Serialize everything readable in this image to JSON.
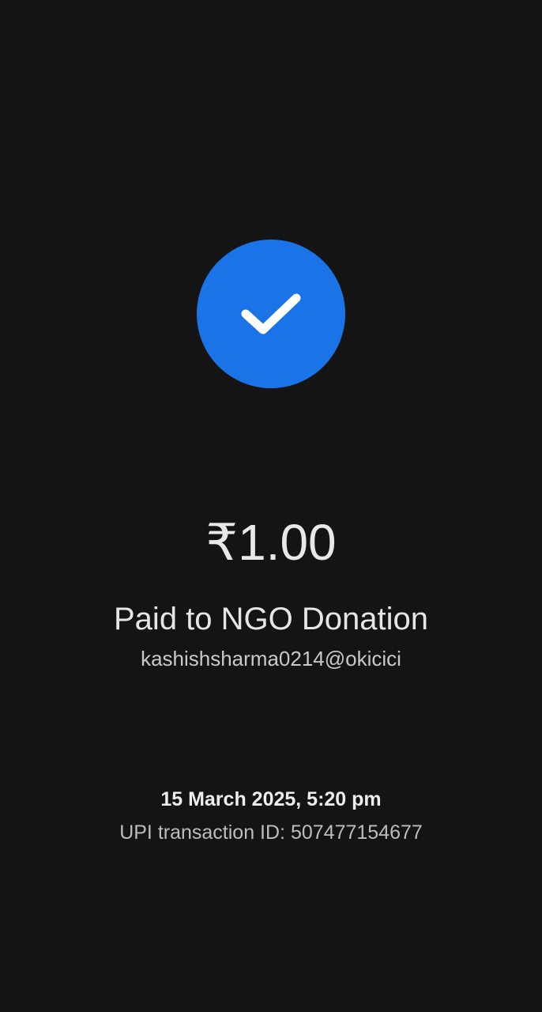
{
  "status": {
    "icon": "check-icon",
    "circle_color": "#1b73e8"
  },
  "payment": {
    "amount": "₹1.00",
    "paid_to": "Paid to NGO Donation",
    "payee_upi_id": "kashishsharma0214@okicici"
  },
  "details": {
    "datetime": "15 March 2025, 5:20 pm",
    "transaction_id": "UPI transaction ID: 507477154677"
  }
}
